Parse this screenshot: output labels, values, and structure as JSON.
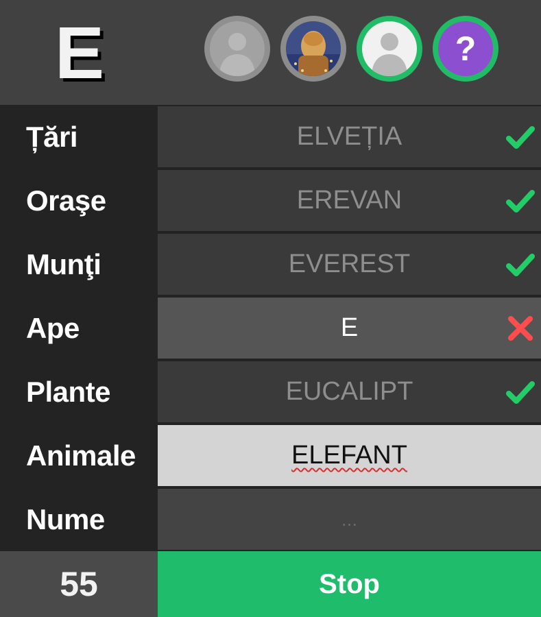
{
  "round": {
    "letter": "E"
  },
  "players": [
    {
      "avatar": "default-user-avatar-gray",
      "status": "inactive"
    },
    {
      "avatar": "photo-avatar",
      "status": "inactive"
    },
    {
      "avatar": "default-user-avatar-light",
      "status": "active"
    },
    {
      "avatar": "question-mark-avatar",
      "status": "active",
      "symbol": "?"
    }
  ],
  "categories": [
    {
      "label": "Țări",
      "answer": "ELVEȚIA",
      "result": "check-icon"
    },
    {
      "label": "Oraşe",
      "answer": "EREVAN",
      "result": "check-icon"
    },
    {
      "label": "Munţi",
      "answer": "EVEREST",
      "result": "check-icon"
    },
    {
      "label": "Ape",
      "answer": "E",
      "result": "cross-icon"
    },
    {
      "label": "Plante",
      "answer": "EUCALIPT",
      "result": "check-icon"
    },
    {
      "label": "Animale",
      "answer": "ELEFANT",
      "result": ""
    },
    {
      "label": "Nume",
      "answer": "...",
      "result": ""
    }
  ],
  "footer": {
    "score": "55",
    "stop_label": "Stop"
  },
  "colors": {
    "check": "#22cc66",
    "cross": "#ff4d4d",
    "stop_button": "#1fbc6c"
  }
}
